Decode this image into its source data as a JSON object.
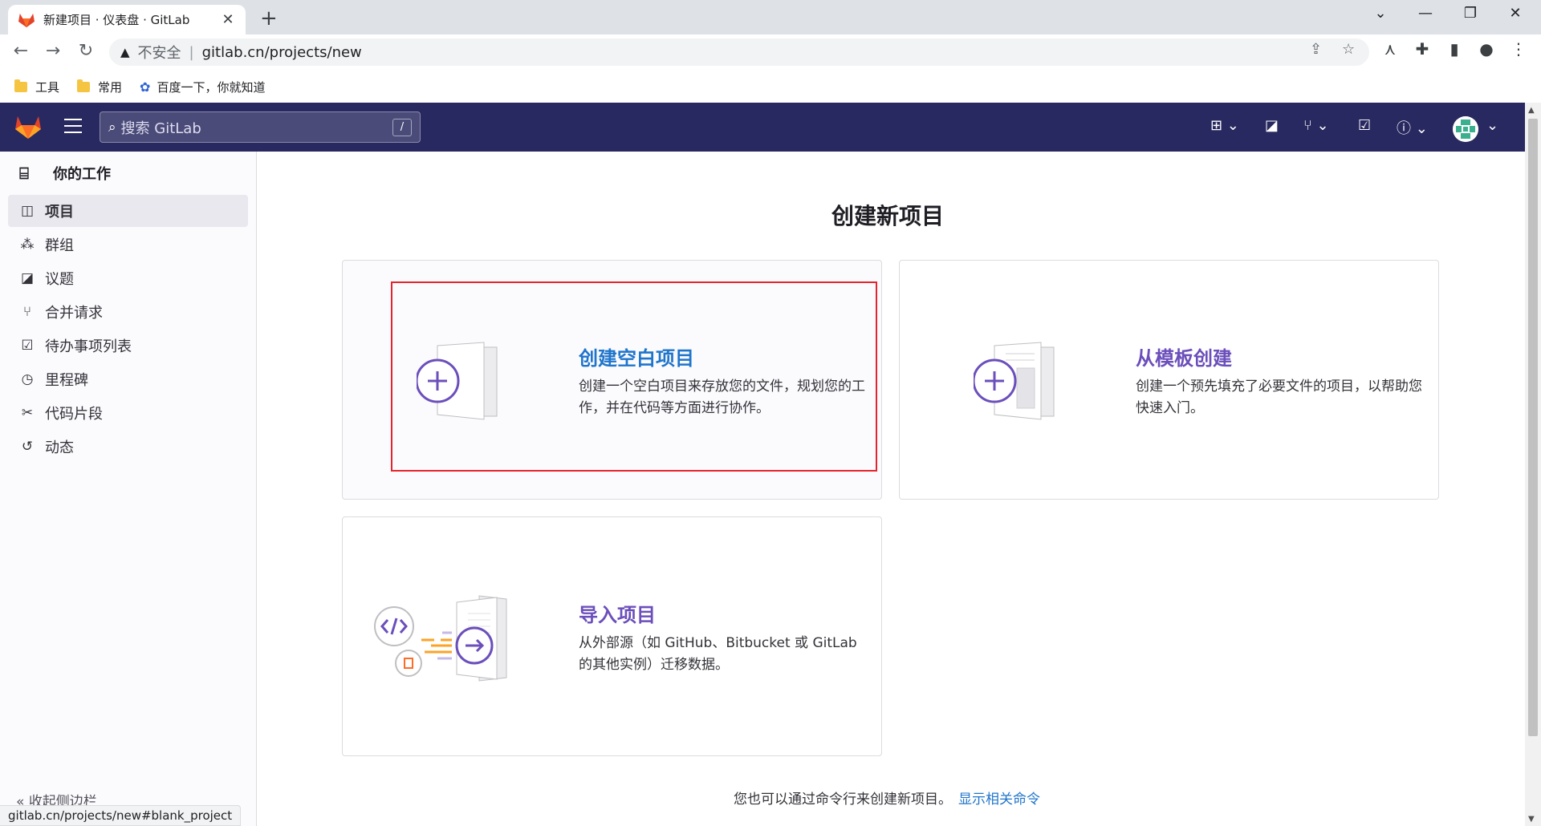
{
  "browser": {
    "tab_title": "新建项目 · 仪表盘 · GitLab",
    "tab_close": "✕",
    "new_tab": "+",
    "insecure_label": "不安全",
    "separator": "|",
    "url": "gitlab.cn/projects/new",
    "bookmarks": [
      {
        "label": "工具",
        "icon": "folder-icon"
      },
      {
        "label": "常用",
        "icon": "folder-icon"
      },
      {
        "label": "百度一下，你就知道",
        "icon": "baidu-icon"
      }
    ],
    "status_url": "gitlab.cn/projects/new#blank_project"
  },
  "header": {
    "search_placeholder": "搜索 GitLab",
    "search_shortcut": "/",
    "colors": {
      "bg": "#292961"
    }
  },
  "sidebar": {
    "context_title": "你的工作",
    "items": [
      {
        "label": "项目",
        "icon": "project-icon",
        "active": true
      },
      {
        "label": "群组",
        "icon": "group-icon",
        "active": false
      },
      {
        "label": "议题",
        "icon": "issues-icon",
        "active": false
      },
      {
        "label": "合并请求",
        "icon": "merge-request-icon",
        "active": false
      },
      {
        "label": "待办事项列表",
        "icon": "todo-icon",
        "active": false
      },
      {
        "label": "里程碑",
        "icon": "milestone-icon",
        "active": false
      },
      {
        "label": "代码片段",
        "icon": "snippet-icon",
        "active": false
      },
      {
        "label": "动态",
        "icon": "activity-icon",
        "active": false
      }
    ],
    "collapse_label": "收起侧边栏"
  },
  "main": {
    "title": "创建新项目",
    "cards": [
      {
        "title": "创建空白项目",
        "desc_line1": "创建一个空白项目来存放您的文件，规划您的工",
        "desc_line2": "作，并在代码等方面进行协作。",
        "title_color": "#1f75cb"
      },
      {
        "title": "从模板创建",
        "desc_line1": "创建一个预先填充了必要文件的项目，以帮助您",
        "desc_line2": "快速入门。",
        "title_color": "#6b4fbb"
      },
      {
        "title": "导入项目",
        "desc_line1": "从外部源（如 GitHub、Bitbucket 或 GitLab",
        "desc_line2": "的其他实例）迁移数据。",
        "title_color": "#6b4fbb"
      }
    ],
    "cli_text": "您也可以通过命令行来创建新项目。",
    "cli_link": "显示相关命令"
  }
}
